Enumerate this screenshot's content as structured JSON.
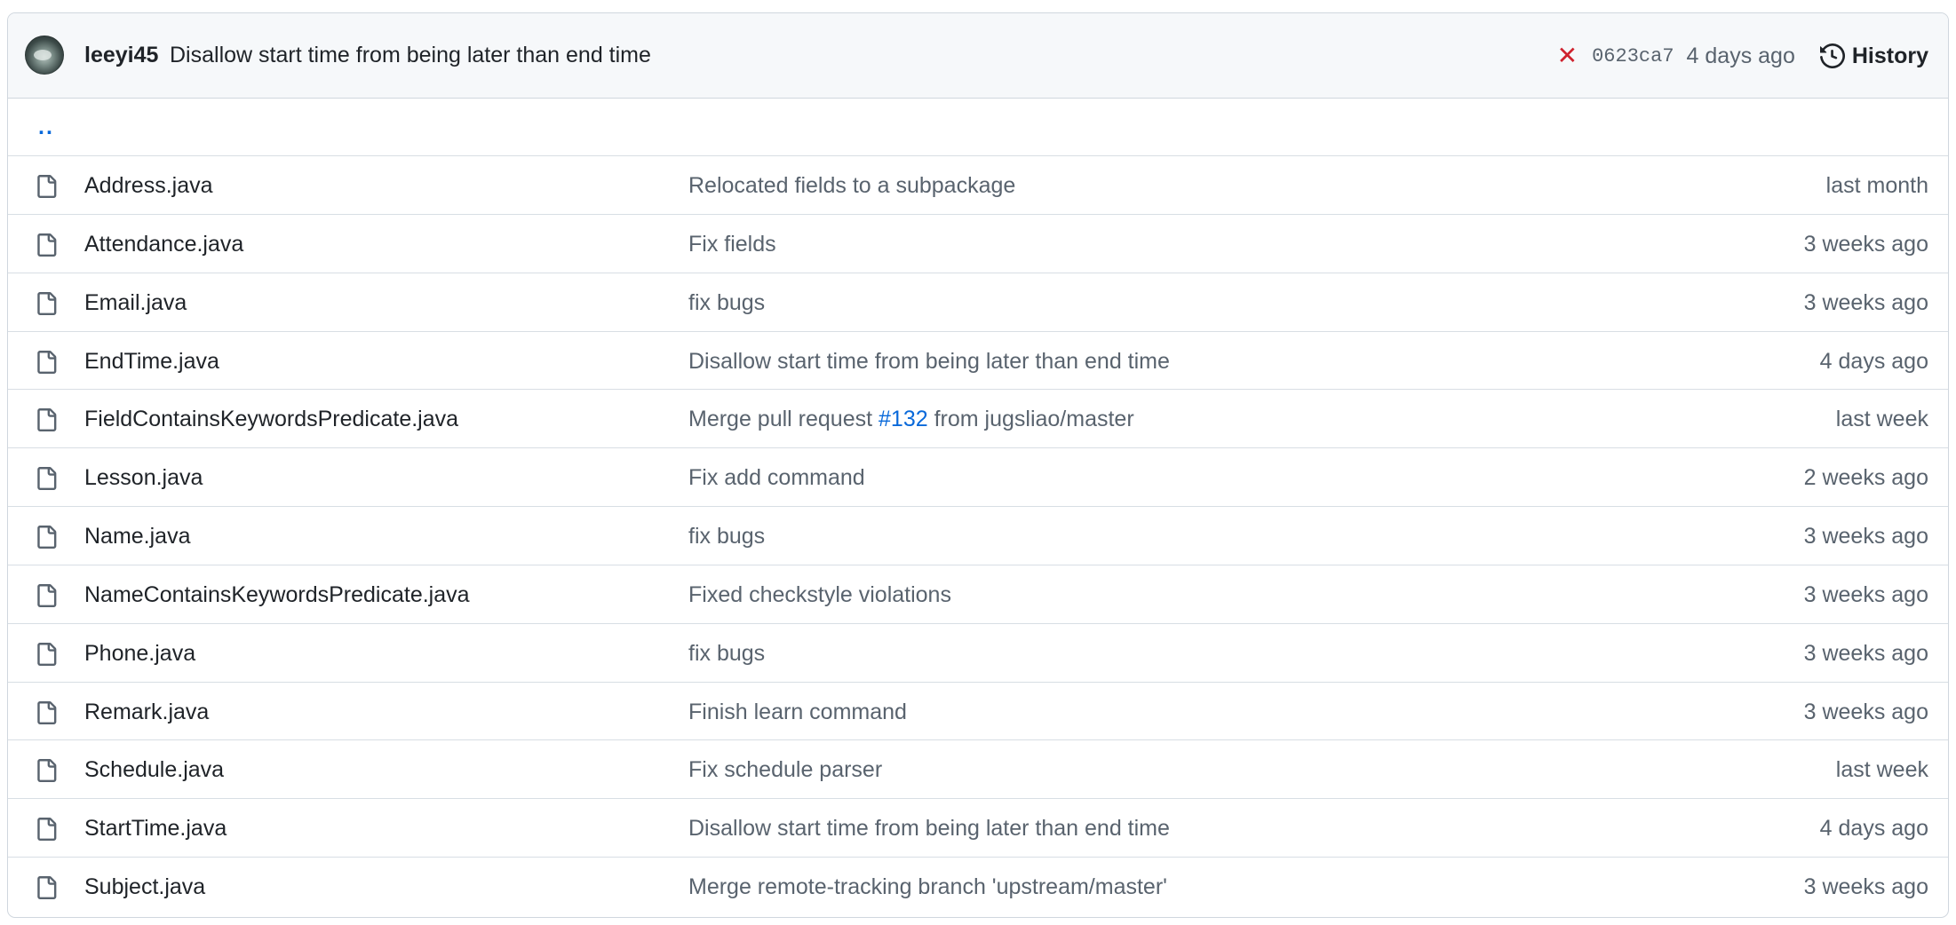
{
  "commit": {
    "author": "leeyi45",
    "message": "Disallow start time from being later than end time",
    "status_icon": "x-icon",
    "status_color": "#cf222e",
    "sha": "0623ca7",
    "age": "4 days ago",
    "history_label": "History"
  },
  "parent_link": "..",
  "files": [
    {
      "name": "Address.java",
      "commit": "Relocated fields to a subpackage",
      "age": "last month"
    },
    {
      "name": "Attendance.java",
      "commit": "Fix fields",
      "age": "3 weeks ago"
    },
    {
      "name": "Email.java",
      "commit": "fix bugs",
      "age": "3 weeks ago"
    },
    {
      "name": "EndTime.java",
      "commit": "Disallow start time from being later than end time",
      "age": "4 days ago"
    },
    {
      "name": "FieldContainsKeywordsPredicate.java",
      "commit_pre": "Merge pull request ",
      "commit_link": "#132",
      "commit_post": " from jugsliao/master",
      "age": "last week"
    },
    {
      "name": "Lesson.java",
      "commit": "Fix add command",
      "age": "2 weeks ago"
    },
    {
      "name": "Name.java",
      "commit": "fix bugs",
      "age": "3 weeks ago"
    },
    {
      "name": "NameContainsKeywordsPredicate.java",
      "commit": "Fixed checkstyle violations",
      "age": "3 weeks ago"
    },
    {
      "name": "Phone.java",
      "commit": "fix bugs",
      "age": "3 weeks ago"
    },
    {
      "name": "Remark.java",
      "commit": "Finish learn command",
      "age": "3 weeks ago"
    },
    {
      "name": "Schedule.java",
      "commit": "Fix schedule parser",
      "age": "last week"
    },
    {
      "name": "StartTime.java",
      "commit": "Disallow start time from being later than end time",
      "age": "4 days ago"
    },
    {
      "name": "Subject.java",
      "commit": "Merge remote-tracking branch 'upstream/master'",
      "age": "3 weeks ago"
    }
  ]
}
